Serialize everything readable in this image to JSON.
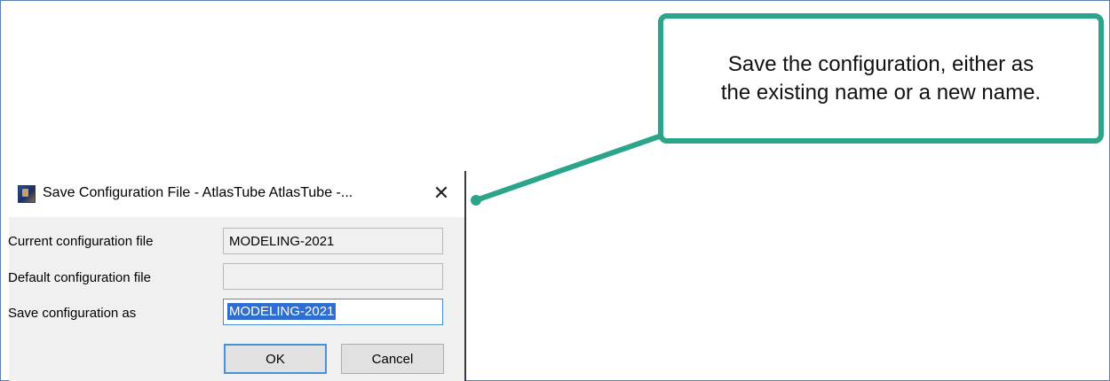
{
  "dialog": {
    "title": "Save Configuration File - AtlasTube AtlasTube -...",
    "close_glyph": "✕",
    "rows": [
      {
        "label": "Current configuration file",
        "value": "MODELING-2021"
      },
      {
        "label": "Default configuration file",
        "value": ""
      },
      {
        "label": "Save configuration as",
        "value": "MODELING-2021"
      }
    ],
    "ok_label": "OK",
    "cancel_label": "Cancel"
  },
  "callout": {
    "line1": "Save the configuration, either as",
    "line2": "the existing name or a new name."
  },
  "colors": {
    "callout_border": "#2aa58a",
    "selection": "#2f6ed1",
    "focus_border": "#4a90d9"
  },
  "icons": {
    "app": "app-icon",
    "close": "close-icon"
  }
}
